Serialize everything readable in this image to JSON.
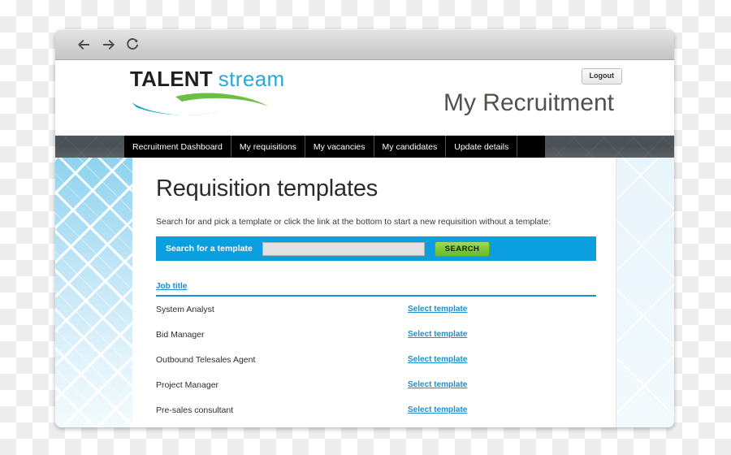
{
  "browser": {
    "back_icon": "arrow-left-icon",
    "forward_icon": "arrow-right-icon",
    "reload_icon": "reload-icon"
  },
  "header": {
    "logo": {
      "talent": "TALENT",
      "stream": "stream",
      "swoosh_green": "#6cbe45",
      "swoosh_teal": "#13a0c3"
    },
    "page_title": "My Recruitment",
    "logout_label": "Logout"
  },
  "nav": {
    "tabs": [
      {
        "label": "Recruitment Dashboard"
      },
      {
        "label": "My requisitions"
      },
      {
        "label": "My vacancies"
      },
      {
        "label": "My candidates"
      },
      {
        "label": "Update details"
      }
    ]
  },
  "main": {
    "title": "Requisition templates",
    "intro": "Search for and pick a template or click the link at the bottom to start a new requisition without a template:",
    "search": {
      "label": "Search for a template",
      "value": "",
      "placeholder": "",
      "button_label": "SEARCH",
      "bar_color": "#0b9fe0",
      "button_color": "#7fc93b"
    },
    "table": {
      "column_header": "Job title",
      "link_label": "Select template",
      "rows": [
        {
          "title": "System Analyst",
          "action": "Select template"
        },
        {
          "title": "Bid Manager",
          "action": "Select template"
        },
        {
          "title": "Outbound Telesales Agent",
          "action": "Select template"
        },
        {
          "title": "Project Manager",
          "action": "Select template"
        },
        {
          "title": "Pre-sales consultant",
          "action": "Select template"
        }
      ]
    },
    "accent_color": "#1b8fd1"
  }
}
